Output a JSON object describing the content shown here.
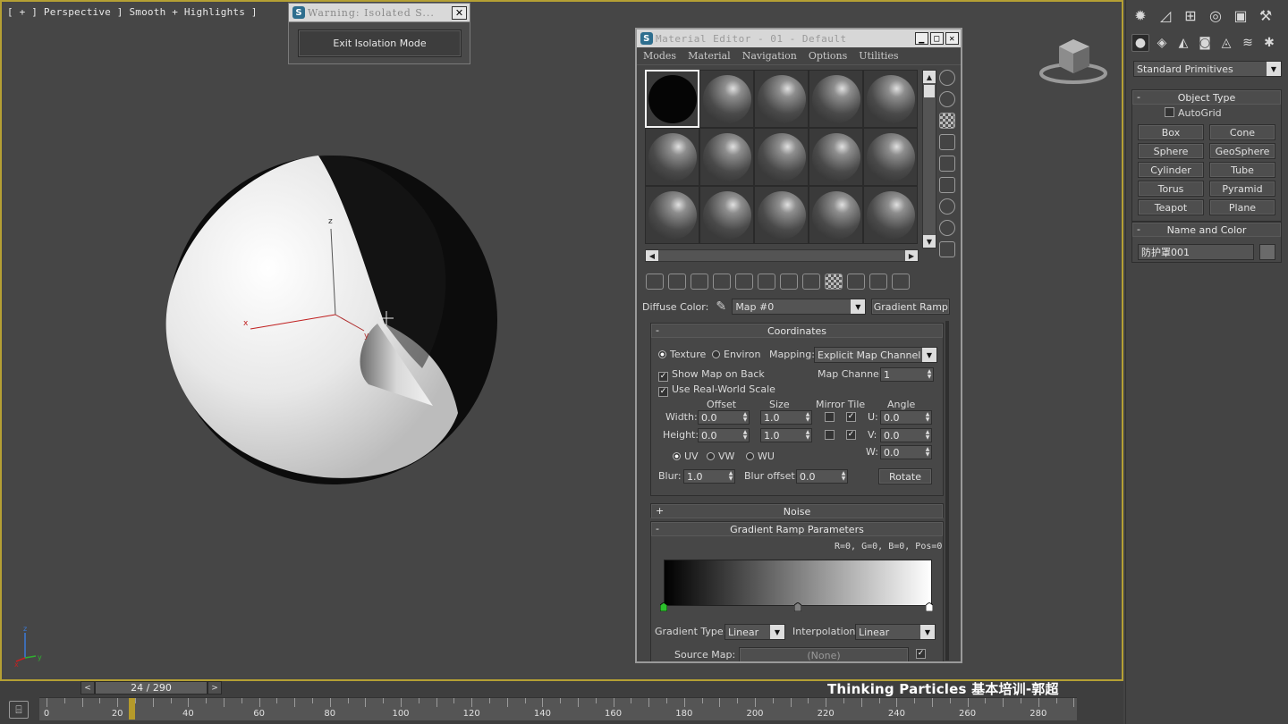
{
  "viewport": {
    "label": "[ + ] Perspective ] Smooth + Highlights ]",
    "axes": {
      "x": "x",
      "y": "y",
      "z": "z"
    }
  },
  "warning": {
    "title": "Warning: Isolated S...",
    "close": "✕",
    "exit_button": "Exit Isolation Mode"
  },
  "material_editor": {
    "title": "Material Editor - 01 - Default",
    "menu": [
      "Modes",
      "Material",
      "Navigation",
      "Options",
      "Utilities"
    ],
    "diffuse_label": "Diffuse Color:",
    "map_name": "Map #0",
    "map_type": "Gradient Ramp",
    "coordinates": {
      "header": "Coordinates",
      "texture": "Texture",
      "environ": "Environ",
      "mapping_label": "Mapping:",
      "mapping_value": "Explicit Map Channel",
      "show_map_on_back": "Show Map on Back",
      "map_channel_label": "Map Channel:",
      "map_channel_value": "1",
      "use_real_world": "Use Real-World Scale",
      "offset": "Offset",
      "size": "Size",
      "mirror_tile": "Mirror Tile",
      "angle": "Angle",
      "width_label": "Width:",
      "height_label": "Height:",
      "width_offset": "0.0",
      "height_offset": "0.0",
      "width_size": "1.0",
      "height_size": "1.0",
      "u_label": "U:",
      "v_label": "V:",
      "w_label": "W:",
      "u_val": "0.0",
      "v_val": "0.0",
      "w_val": "0.0",
      "uv": "UV",
      "vw": "VW",
      "wu": "WU",
      "blur_label": "Blur:",
      "blur_val": "1.0",
      "blur_offset_label": "Blur offset:",
      "blur_offset_val": "0.0",
      "rotate": "Rotate"
    },
    "noise_header": "Noise",
    "gradient": {
      "header": "Gradient Ramp Parameters",
      "readout": "R=0, G=0, B=0,  Pos=0",
      "type_label": "Gradient Type:",
      "type_value": "Linear",
      "interp_label": "Interpolation:",
      "interp_value": "Linear",
      "source_label": "Source Map:",
      "source_value": "(None)"
    }
  },
  "command_panel": {
    "dropdown": "Standard Primitives",
    "object_type_header": "Object Type",
    "autogrid": "AutoGrid",
    "primitives": [
      "Box",
      "Cone",
      "Sphere",
      "GeoSphere",
      "Cylinder",
      "Tube",
      "Torus",
      "Pyramid",
      "Teapot",
      "Plane"
    ],
    "name_color_header": "Name and Color",
    "object_name": "防护罩001"
  },
  "timeline": {
    "frame_display": "24 / 290",
    "prev": "<",
    "next": ">",
    "ticks": [
      "0",
      "20",
      "40",
      "60",
      "80",
      "100",
      "120",
      "140",
      "160",
      "180",
      "200",
      "220",
      "240",
      "260",
      "280"
    ],
    "current_frame": 24,
    "total_frames": 290
  },
  "caption": "Thinking Particles 基本培训-郭超",
  "colors": {
    "viewport_border": "#b5a034",
    "gradient_start": "#000000",
    "gradient_end": "#ffffff",
    "time_marker": "#b59a2a"
  }
}
